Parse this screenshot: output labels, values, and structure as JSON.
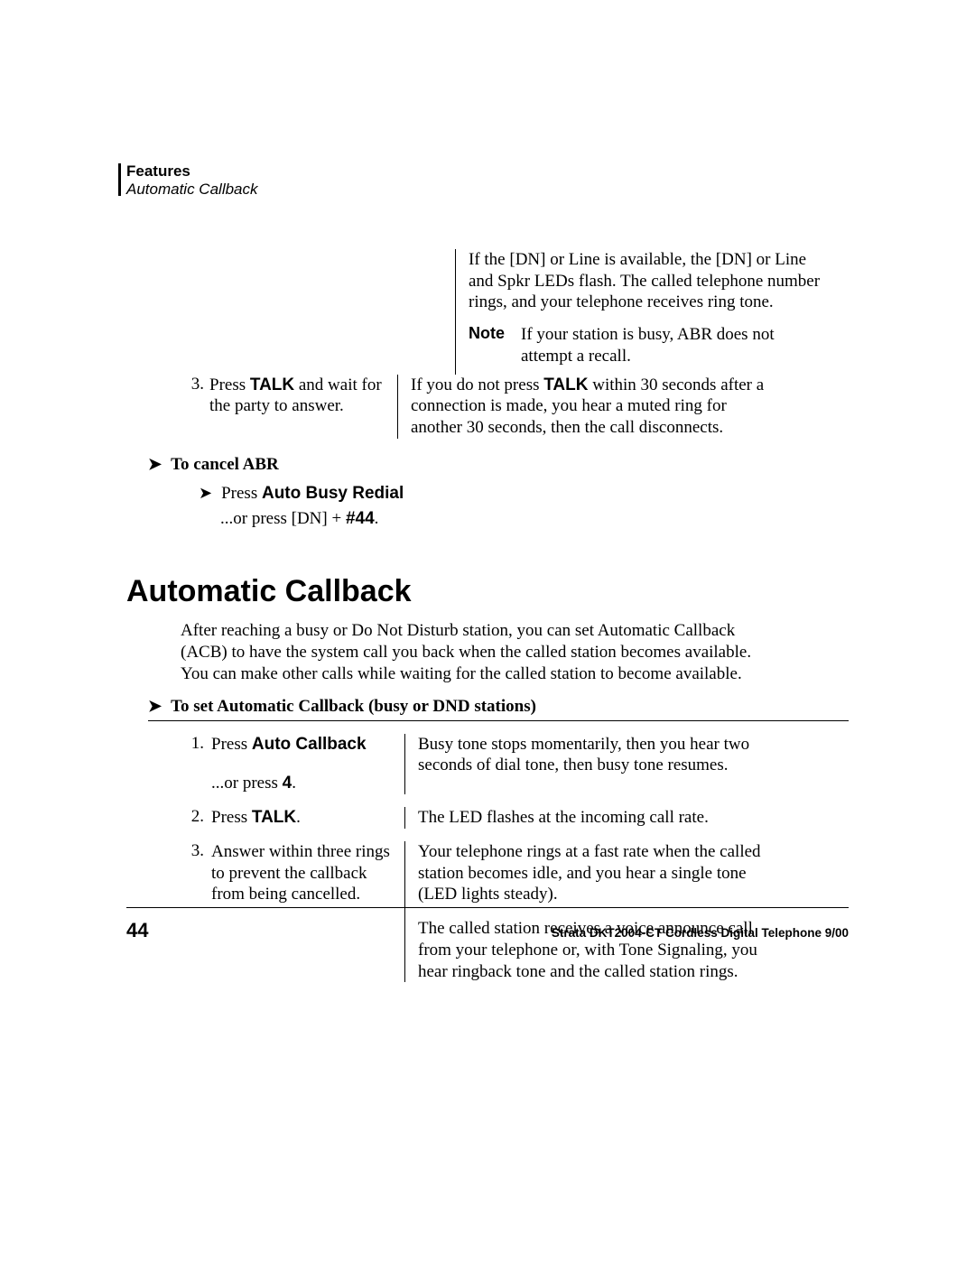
{
  "header": {
    "chapter": "Features",
    "topic": "Automatic Callback"
  },
  "abr_continued": {
    "right_intro": "If the [DN] or Line is available, the [DN] or Line and Spkr LEDs flash. The called telephone number rings, and your telephone receives ring tone.",
    "note_label": "Note",
    "note_text": "If your station is busy, ABR does not attempt a recall.",
    "step3_num": "3.",
    "step3_left_pre": "Press ",
    "step3_left_bold": "TALK",
    "step3_left_post": " and wait for the party to answer.",
    "step3_right_pre": "If you do not press ",
    "step3_right_bold": "TALK",
    "step3_right_post": " within 30 seconds after a connection is made, you hear a muted ring for another 30 seconds, then the call disconnects."
  },
  "cancel_abr": {
    "heading": "To cancel ABR",
    "press_label": "Press ",
    "press_bold": "Auto Busy Redial",
    "or_line_pre": "...or press [DN] + ",
    "or_line_bold": "#44",
    "or_line_post": "."
  },
  "section": {
    "title": "Automatic Callback",
    "body": "After reaching a busy or Do Not Disturb station, you can set Automatic Callback (ACB) to have the system call you back when the called station becomes available. You can make other calls while waiting for the called station to become available."
  },
  "set_acb": {
    "heading": "To set Automatic Callback (busy or DND stations)",
    "rows": [
      {
        "num": "1.",
        "left_pre": "Press ",
        "left_bold": "Auto Callback",
        "left_post": "",
        "left_extra_pre": "...or press ",
        "left_extra_bold": "4",
        "left_extra_post": ".",
        "right": "Busy tone stops momentarily, then you hear two seconds of dial tone, then busy tone resumes.",
        "right2": ""
      },
      {
        "num": "2.",
        "left_pre": "Press ",
        "left_bold": "TALK",
        "left_post": ".",
        "left_extra_pre": "",
        "left_extra_bold": "",
        "left_extra_post": "",
        "right": "The LED flashes at the incoming call rate.",
        "right2": ""
      },
      {
        "num": "3.",
        "left_pre": "",
        "left_bold": "",
        "left_post": "Answer within three rings to prevent the callback from being cancelled.",
        "left_extra_pre": "",
        "left_extra_bold": "",
        "left_extra_post": "",
        "right": "Your telephone rings at a fast rate when the called station becomes idle, and you hear a single tone (LED lights steady).",
        "right2": "The called station receives a voice announce call from your telephone or, with Tone Signaling, you hear ringback tone and the called station rings."
      }
    ]
  },
  "footer": {
    "page": "44",
    "text": "Strata DKT2004-CT Cordless Digital Telephone  9/00"
  },
  "glyphs": {
    "arrow": "➤"
  }
}
